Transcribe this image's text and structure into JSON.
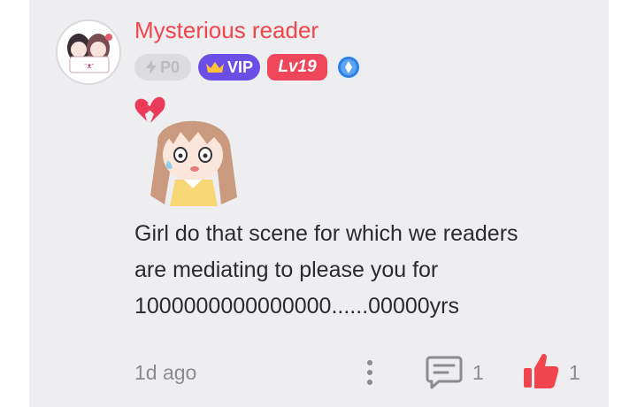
{
  "comment": {
    "username": "Mysterious reader",
    "badges": {
      "power": "P0",
      "vip": "VIP",
      "level": "Lv19"
    },
    "text_lines": [
      "Girl do that scene for which we readers",
      "are mediating to please you for",
      "1000000000000000......00000yrs"
    ],
    "time": "1d ago",
    "reply_count": "1",
    "like_count": "1"
  },
  "colors": {
    "username": "#f0454c",
    "vip_badge": "#6b4ee6",
    "level_badge": "#f0465a",
    "like": "#f0454c",
    "card_background": "#eeeef0"
  },
  "icons": {
    "avatar": "anime-avatar",
    "power": "lightning-icon",
    "vip": "crown-icon",
    "extra_badge": "blue-gem-icon",
    "sticker": "anime-girl-broken-heart-sticker",
    "more": "vertical-dots-icon",
    "reply": "comment-icon",
    "like": "thumbs-up-icon"
  }
}
